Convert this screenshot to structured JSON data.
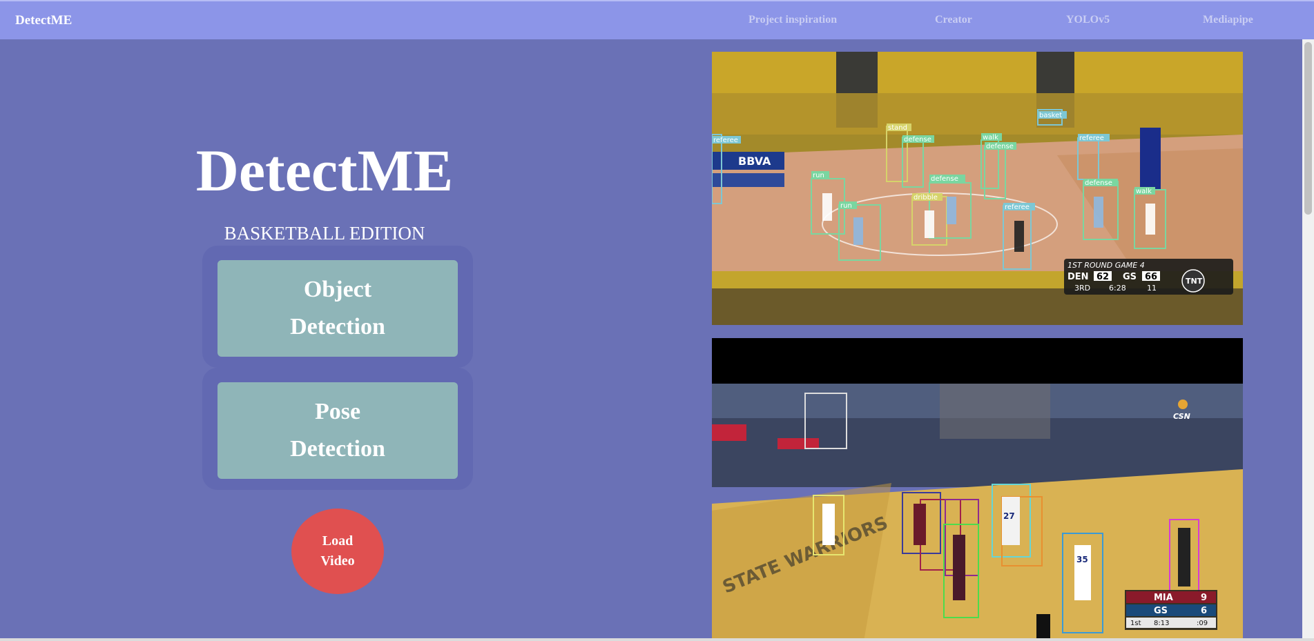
{
  "navbar": {
    "brand": "DetectME",
    "links": [
      "Project inspiration",
      "Creator",
      "YOLOv5",
      "Mediapipe"
    ]
  },
  "hero": {
    "title": "DetectME",
    "subtitle": "BASKETBALL EDITION"
  },
  "buttons": {
    "object_detection_line1": "Object",
    "object_detection_line2": "Detection",
    "pose_detection_line1": "Pose",
    "pose_detection_line2": "Detection",
    "load_video_line1": "Load",
    "load_video_line2": "Video"
  },
  "video1": {
    "labels": [
      "referee",
      "stand",
      "defense",
      "walk",
      "defense",
      "basket",
      "referee",
      "run",
      "run",
      "dribble",
      "defense",
      "referee",
      "defense",
      "walk"
    ],
    "sponsor": "BBVA",
    "scoreboard": {
      "round": "1ST ROUND GAME 4",
      "team1": "DEN",
      "score1": "62",
      "team2": "GS",
      "score2": "66",
      "quarter": "3RD",
      "clock": "6:28",
      "shot_clock": "11",
      "network": "TNT"
    }
  },
  "video2": {
    "network": "CSN",
    "scoreboard": {
      "team1": "MIA",
      "score1": "9",
      "team2": "GS",
      "score2": "6",
      "quarter": "1st",
      "clock": "8:13",
      "shot_clock": ":09"
    },
    "jersey_numbers": [
      "27",
      "35"
    ]
  },
  "colors": {
    "background": "#6a71b6",
    "navbar": "#8c95e8",
    "button": "#8fb5b8",
    "load_button": "#e05050"
  }
}
